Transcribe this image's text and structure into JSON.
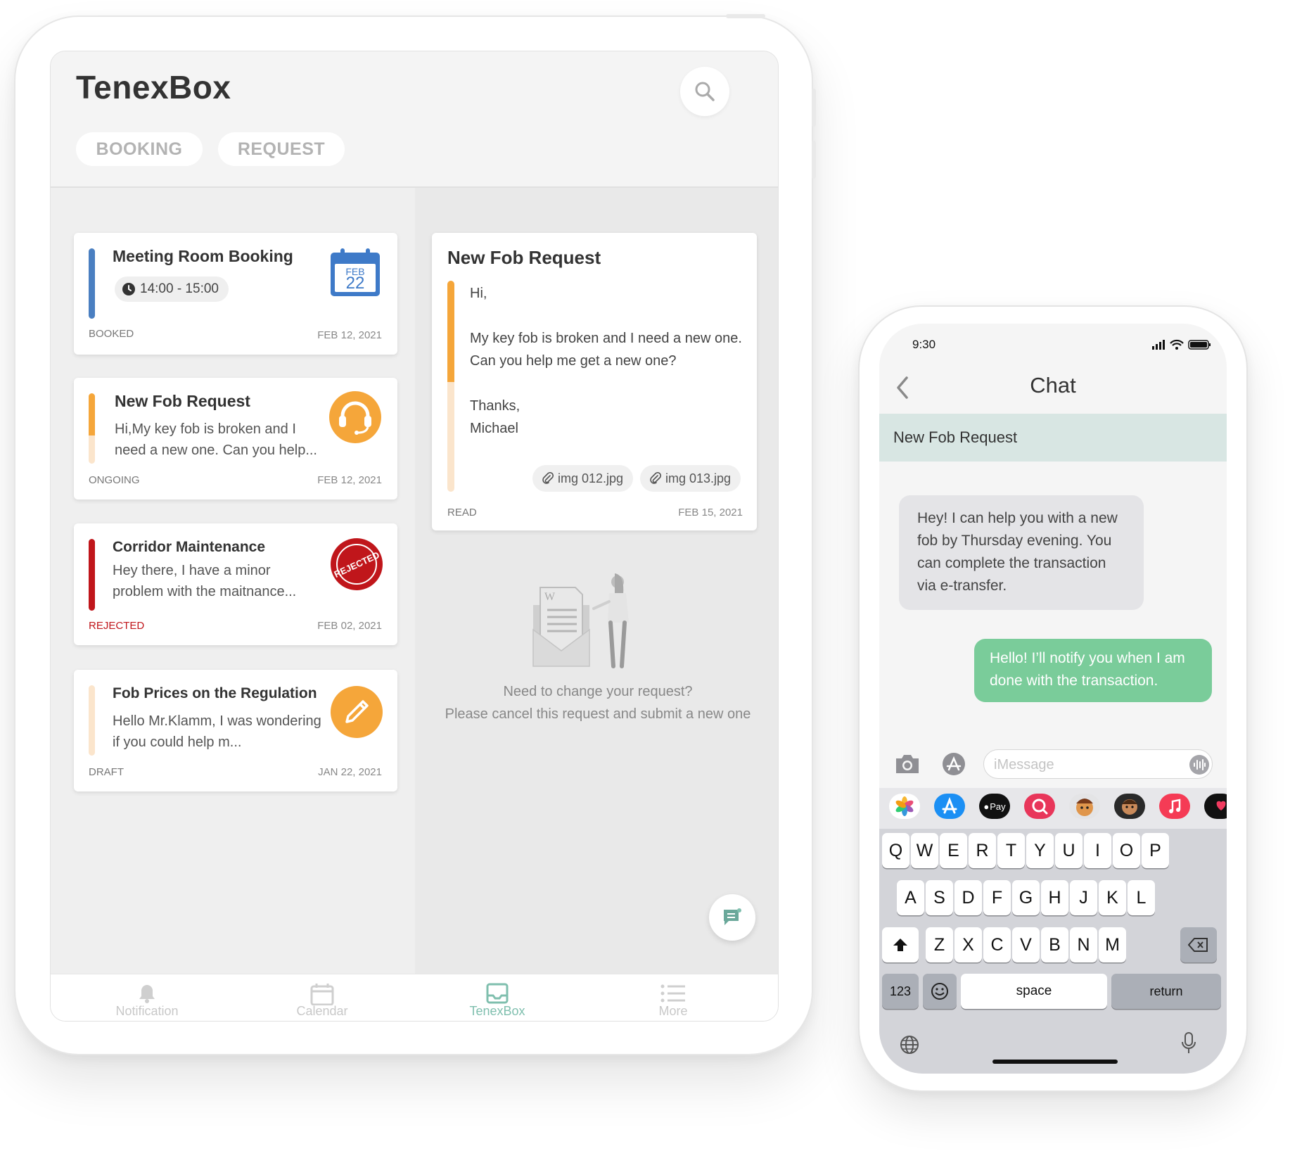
{
  "tablet": {
    "app_title": "TenexBox",
    "tabs": [
      {
        "label": "BOOKING"
      },
      {
        "label": "REQUEST"
      }
    ],
    "cards": [
      {
        "title": "Meeting Room Booking",
        "time": "14:00 - 15:00",
        "status": "BOOKED",
        "date": "FEB 12, 2021",
        "icon": "calendar-icon",
        "icon_month": "FEB",
        "icon_day": "22",
        "bar_color": "#4a7fc1"
      },
      {
        "title": "New Fob Request",
        "text": "Hi,My key fob is broken and I need a new one. Can you help...",
        "status": "ONGOING",
        "date": "FEB 12, 2021",
        "icon": "headset-icon",
        "bar_color": "#f5a63a"
      },
      {
        "title": "Corridor Maintenance",
        "text": "Hey there, I have a minor problem with the maitnance...",
        "status": "REJECTED",
        "date": "FEB 02, 2021",
        "icon": "rejected-stamp-icon",
        "icon_text": "REJECTED",
        "bar_color": "#c0161b",
        "status_color": "#c0161b"
      },
      {
        "title": "Fob Prices on the Regulation",
        "text": "Hello Mr.Klamm,  I was wondering if you could help m...",
        "status": "DRAFT",
        "date": "JAN 22, 2021",
        "icon": "pencil-icon",
        "bar_color": "#fbe5cc"
      }
    ],
    "detail": {
      "title": "New Fob Request",
      "greeting": "Hi,",
      "body": "My key fob is broken and I need a new one. Can you help me get a new one?",
      "signoff": "Thanks,",
      "signature": "Michael",
      "attachments": [
        "img 012.jpg",
        "img 013.jpg"
      ],
      "status": "READ",
      "date": "FEB 15, 2021"
    },
    "empty_state": {
      "line1": "Need to change your request?",
      "line2": "Please cancel this request and submit a new one"
    },
    "nav": [
      {
        "label": "Notification",
        "icon": "bell-icon"
      },
      {
        "label": "Calendar",
        "icon": "calendar-icon"
      },
      {
        "label": "TenexBox",
        "icon": "inbox-icon",
        "active": true
      },
      {
        "label": "More",
        "icon": "list-icon"
      }
    ],
    "accent": "#7fbfae"
  },
  "phone": {
    "status_time": "9:30",
    "title": "Chat",
    "banner": "New Fob Request",
    "messages": [
      {
        "from": "agent",
        "text": "Hey! I can help you with a new fob by Thursday evening. You can complete the transaction via e-transfer."
      },
      {
        "from": "me",
        "text": "Hello! I’ll notify you when I am done with the transaction."
      }
    ],
    "input_placeholder": "iMessage",
    "keyboard": {
      "row1": [
        "Q",
        "W",
        "E",
        "R",
        "T",
        "Y",
        "U",
        "I",
        "O",
        "P"
      ],
      "row2": [
        "A",
        "S",
        "D",
        "F",
        "G",
        "H",
        "J",
        "K",
        "L"
      ],
      "row3": [
        "Z",
        "X",
        "C",
        "V",
        "B",
        "N",
        "M"
      ],
      "numbers": "123",
      "space": "space",
      "return": "return"
    },
    "apple_pay_label": "Pay",
    "bubble_out_color": "#7acc9a"
  }
}
